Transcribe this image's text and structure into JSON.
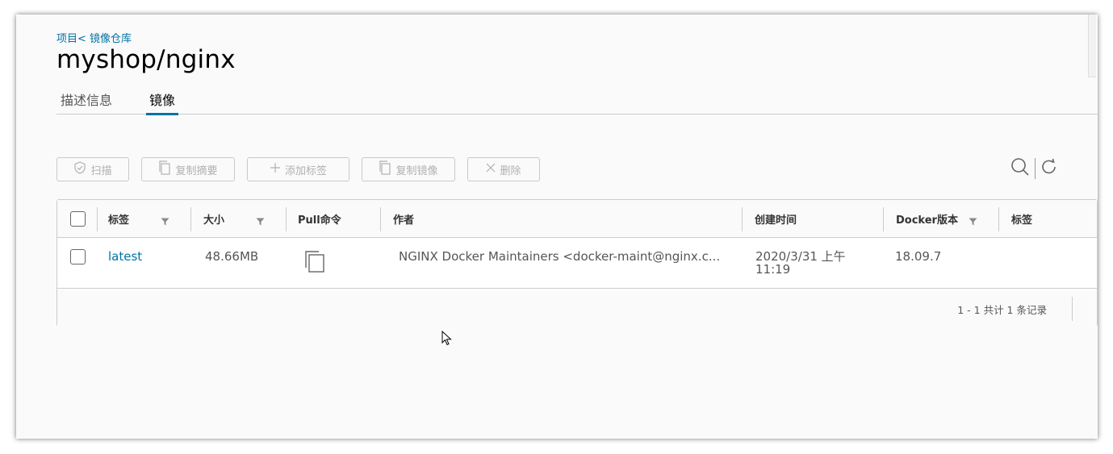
{
  "breadcrumb": {
    "text": "项目< 镜像仓库"
  },
  "page_title": "myshop/nginx",
  "tabs": [
    {
      "label": "描述信息"
    },
    {
      "label": "镜像"
    }
  ],
  "toolbar": {
    "scan": "扫描",
    "copy_digest": "复制摘要",
    "add_label": "添加标签",
    "copy_image": "复制镜像",
    "delete": "删除"
  },
  "table": {
    "columns": [
      "标签",
      "大小",
      "Pull命令",
      "作者",
      "创建时间",
      "Docker版本",
      "标签"
    ],
    "rows": [
      {
        "tag": "latest",
        "size": "48.66MB",
        "author": "NGINX Docker Maintainers <docker-maint@nginx.c...",
        "created_date": "2020/3/31 上午",
        "created_time": "11:19",
        "docker_version": "18.09.7"
      }
    ],
    "footer": "1 - 1 共计 1 条记录"
  },
  "colors": {
    "accent": "#0072a3",
    "border": "#cccccc",
    "disabled": "#b0b0b0"
  },
  "icons": [
    "shield-check-icon",
    "copy-icon",
    "plus-icon",
    "close-icon",
    "search-icon",
    "refresh-icon",
    "filter-icon",
    "mouse-cursor-icon"
  ]
}
